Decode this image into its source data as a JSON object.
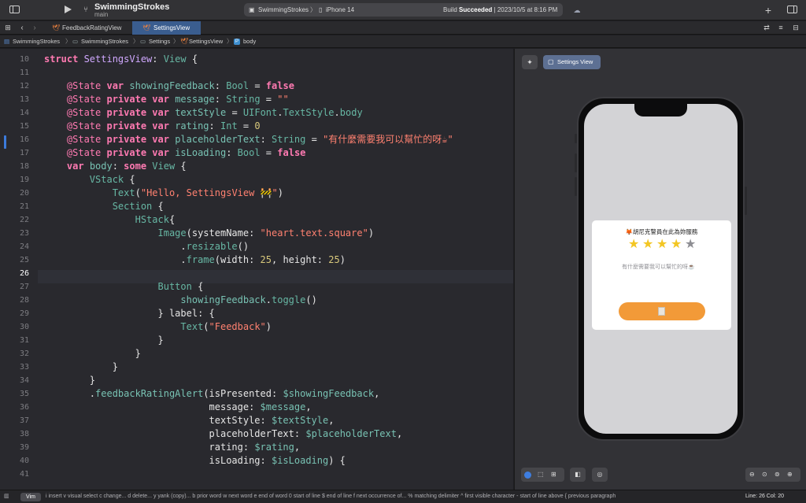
{
  "titlebar": {
    "sidebar_icon": "sidebar-toggle-icon",
    "run_icon": "play-icon",
    "scheme": "SwimmingStrokes",
    "branch": "main",
    "destination_scheme": "SwimmingStrokes",
    "destination_device": "iPhone 14",
    "build_status_prefix": "Build",
    "build_status_word": "Succeeded",
    "build_time": "2023/10/5 at 8:16 PM",
    "add_icon": "plus-icon",
    "inspector_icon": "inspector-toggle-icon"
  },
  "tabs": [
    {
      "label": "FeedbackRatingView",
      "active": false
    },
    {
      "label": "SettingsView",
      "active": true
    }
  ],
  "jumpbar": [
    "SwimmingStrokes",
    "SwimmingStrokes",
    "Settings",
    "SettingsView",
    "body"
  ],
  "editor": {
    "current_line": 26,
    "lines": [
      {
        "n": "10",
        "tokens": [
          [
            "kw",
            "struct "
          ],
          [
            "ty",
            "SettingsView"
          ],
          [
            "plain",
            ": "
          ],
          [
            "pr",
            "View"
          ],
          [
            "plain",
            " {"
          ]
        ]
      },
      {
        "n": "11",
        "tokens": []
      },
      {
        "n": "12",
        "tokens": [
          [
            "plain",
            "    "
          ],
          [
            "at",
            "@State "
          ],
          [
            "kw",
            "var "
          ],
          [
            "fn",
            "showingFeedback"
          ],
          [
            "plain",
            ": "
          ],
          [
            "pr",
            "Bool"
          ],
          [
            "plain",
            " = "
          ],
          [
            "kw",
            "false"
          ]
        ]
      },
      {
        "n": "13",
        "tokens": [
          [
            "plain",
            "    "
          ],
          [
            "at",
            "@State "
          ],
          [
            "kw",
            "private var "
          ],
          [
            "fn",
            "message"
          ],
          [
            "plain",
            ": "
          ],
          [
            "pr",
            "String"
          ],
          [
            "plain",
            " = "
          ],
          [
            "st",
            "\"\""
          ]
        ]
      },
      {
        "n": "14",
        "tokens": [
          [
            "plain",
            "    "
          ],
          [
            "at",
            "@State "
          ],
          [
            "kw",
            "private var "
          ],
          [
            "fn",
            "textStyle"
          ],
          [
            "plain",
            " = "
          ],
          [
            "pr",
            "UIFont"
          ],
          [
            "plain",
            "."
          ],
          [
            "pr",
            "TextStyle"
          ],
          [
            "plain",
            "."
          ],
          [
            "pr",
            "body"
          ]
        ]
      },
      {
        "n": "15",
        "tokens": [
          [
            "plain",
            "    "
          ],
          [
            "at",
            "@State "
          ],
          [
            "kw",
            "private var "
          ],
          [
            "fn",
            "rating"
          ],
          [
            "plain",
            ": "
          ],
          [
            "pr",
            "Int"
          ],
          [
            "plain",
            " = "
          ],
          [
            "nm",
            "0"
          ]
        ]
      },
      {
        "n": "16",
        "tokens": [
          [
            "plain",
            "    "
          ],
          [
            "at",
            "@State "
          ],
          [
            "kw",
            "private var "
          ],
          [
            "fn",
            "placeholderText"
          ],
          [
            "plain",
            ": "
          ],
          [
            "pr",
            "String"
          ],
          [
            "plain",
            " = "
          ],
          [
            "st",
            "\"有什麼需要我可以幫忙的呀☕\""
          ]
        ]
      },
      {
        "n": "17",
        "tokens": [
          [
            "plain",
            "    "
          ],
          [
            "at",
            "@State "
          ],
          [
            "kw",
            "private var "
          ],
          [
            "fn",
            "isLoading"
          ],
          [
            "plain",
            ": "
          ],
          [
            "pr",
            "Bool"
          ],
          [
            "plain",
            " = "
          ],
          [
            "kw",
            "false"
          ]
        ]
      },
      {
        "n": "18",
        "tokens": [
          [
            "plain",
            "    "
          ],
          [
            "kw",
            "var "
          ],
          [
            "fn",
            "body"
          ],
          [
            "plain",
            ": "
          ],
          [
            "kw",
            "some "
          ],
          [
            "pr",
            "View"
          ],
          [
            "plain",
            " {"
          ]
        ]
      },
      {
        "n": "19",
        "tokens": [
          [
            "plain",
            "        "
          ],
          [
            "pr",
            "VStack"
          ],
          [
            "plain",
            " {"
          ]
        ]
      },
      {
        "n": "20",
        "tokens": [
          [
            "plain",
            "            "
          ],
          [
            "pr",
            "Text"
          ],
          [
            "plain",
            "("
          ],
          [
            "st",
            "\"Hello, SettingsView 🚧\""
          ],
          [
            "plain",
            ")"
          ]
        ]
      },
      {
        "n": "21",
        "tokens": [
          [
            "plain",
            "            "
          ],
          [
            "pr",
            "Section"
          ],
          [
            "plain",
            " {"
          ]
        ]
      },
      {
        "n": "22",
        "tokens": [
          [
            "plain",
            "                "
          ],
          [
            "pr",
            "HStack"
          ],
          [
            "plain",
            "{"
          ]
        ]
      },
      {
        "n": "23",
        "tokens": [
          [
            "plain",
            "                    "
          ],
          [
            "pr",
            "Image"
          ],
          [
            "plain",
            "(systemName: "
          ],
          [
            "st",
            "\"heart.text.square\""
          ],
          [
            "plain",
            ")"
          ]
        ]
      },
      {
        "n": "24",
        "tokens": [
          [
            "plain",
            "                        ."
          ],
          [
            "pr",
            "resizable"
          ],
          [
            "plain",
            "()"
          ]
        ]
      },
      {
        "n": "25",
        "tokens": [
          [
            "plain",
            "                        ."
          ],
          [
            "pr",
            "frame"
          ],
          [
            "plain",
            "(width: "
          ],
          [
            "nm",
            "25"
          ],
          [
            "plain",
            ", height: "
          ],
          [
            "nm",
            "25"
          ],
          [
            "plain",
            ")"
          ]
        ]
      },
      {
        "n": "26",
        "tokens": []
      },
      {
        "n": "27",
        "tokens": [
          [
            "plain",
            "                    "
          ],
          [
            "pr",
            "Button"
          ],
          [
            "plain",
            " {"
          ]
        ]
      },
      {
        "n": "28",
        "tokens": [
          [
            "plain",
            "                        "
          ],
          [
            "fn",
            "showingFeedback"
          ],
          [
            "plain",
            "."
          ],
          [
            "pr",
            "toggle"
          ],
          [
            "plain",
            "()"
          ]
        ]
      },
      {
        "n": "29",
        "tokens": [
          [
            "plain",
            "                    } label: {"
          ]
        ]
      },
      {
        "n": "30",
        "tokens": [
          [
            "plain",
            "                        "
          ],
          [
            "pr",
            "Text"
          ],
          [
            "plain",
            "("
          ],
          [
            "st",
            "\"Feedback\""
          ],
          [
            "plain",
            ")"
          ]
        ]
      },
      {
        "n": "31",
        "tokens": [
          [
            "plain",
            "                    }"
          ]
        ]
      },
      {
        "n": "32",
        "tokens": [
          [
            "plain",
            "                }"
          ]
        ]
      },
      {
        "n": "33",
        "tokens": [
          [
            "plain",
            "            }"
          ]
        ]
      },
      {
        "n": "34",
        "tokens": [
          [
            "plain",
            "        }"
          ]
        ]
      },
      {
        "n": "35",
        "tokens": [
          [
            "plain",
            "        ."
          ],
          [
            "fn",
            "feedbackRatingAlert"
          ],
          [
            "plain",
            "(isPresented: "
          ],
          [
            "fn",
            "$showingFeedback"
          ],
          [
            "plain",
            ","
          ]
        ]
      },
      {
        "n": "36",
        "tokens": [
          [
            "plain",
            "                             message: "
          ],
          [
            "fn",
            "$message"
          ],
          [
            "plain",
            ","
          ]
        ]
      },
      {
        "n": "37",
        "tokens": [
          [
            "plain",
            "                             textStyle: "
          ],
          [
            "fn",
            "$textStyle"
          ],
          [
            "plain",
            ","
          ]
        ]
      },
      {
        "n": "38",
        "tokens": [
          [
            "plain",
            "                             placeholderText: "
          ],
          [
            "fn",
            "$placeholderText"
          ],
          [
            "plain",
            ","
          ]
        ]
      },
      {
        "n": "39",
        "tokens": [
          [
            "plain",
            "                             rating: "
          ],
          [
            "fn",
            "$rating"
          ],
          [
            "plain",
            ","
          ]
        ]
      },
      {
        "n": "40",
        "tokens": [
          [
            "plain",
            "                             isLoading: "
          ],
          [
            "fn",
            "$isLoading"
          ],
          [
            "plain",
            ") {"
          ]
        ]
      },
      {
        "n": "41",
        "tokens": []
      }
    ]
  },
  "preview": {
    "pin_icon": "pin-icon",
    "selected_preview": "Settings View",
    "alert": {
      "title": "🦊胡尼克警員在此為妳服務",
      "rating": 4,
      "max_rating": 5,
      "placeholder": "有什麼需要我可以幫忙的呀☕"
    },
    "filled_star_color": "#f3c623",
    "empty_star_color": "#8e8e93",
    "button_color": "#f29a38"
  },
  "statusbar": {
    "mode": "Vim",
    "hints": "i insert  v visual select  c change...  d delete...  y yank (copy)...  b prior word  w next word  e end of word  0 start of line  $ end of line  f next occurrence of...  % matching delimiter  ^ first visible character  - start of line above  { previous paragraph",
    "position": "Line: 26  Col: 20"
  }
}
